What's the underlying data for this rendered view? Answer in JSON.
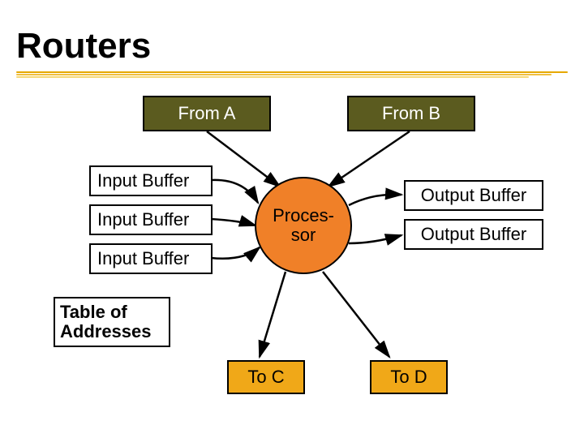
{
  "title": "Routers",
  "fromA": "From A",
  "fromB": "From B",
  "inputBuffer1": "Input Buffer",
  "inputBuffer2": "Input Buffer",
  "inputBuffer3": "Input Buffer",
  "processor": "Proces-\nsor",
  "outputBuffer1": "Output Buffer",
  "outputBuffer2": "Output Buffer",
  "tableOfAddresses": "Table of\nAddresses",
  "toC": "To C",
  "toD": "To D"
}
